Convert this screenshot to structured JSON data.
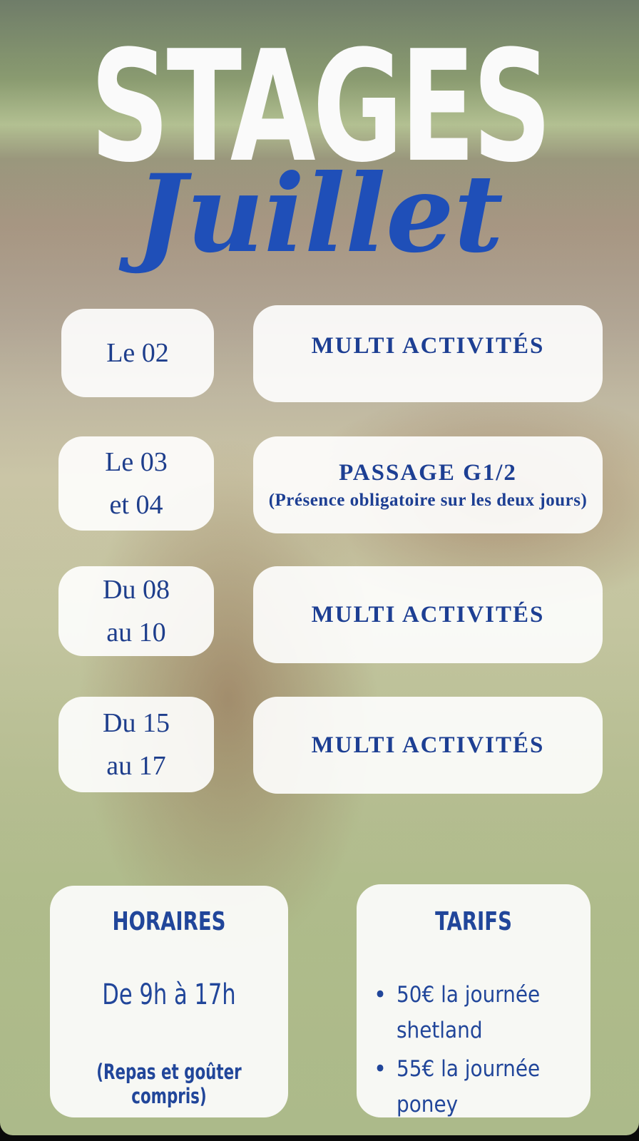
{
  "header": {
    "title": "STAGES",
    "subtitle": "Juillet"
  },
  "schedule": [
    {
      "date_line1": "Le 02",
      "date_line2": "",
      "activity": "MULTI ACTIVITÉS",
      "note": ""
    },
    {
      "date_line1": "Le 03",
      "date_line2": "et 04",
      "activity": "PASSAGE G1/2",
      "note": "(Présence obligatoire sur les deux jours)"
    },
    {
      "date_line1": "Du 08",
      "date_line2": "au 10",
      "activity": "MULTI ACTIVITÉS",
      "note": ""
    },
    {
      "date_line1": "Du 15",
      "date_line2": "au 17",
      "activity": "MULTI ACTIVITÉS",
      "note": ""
    }
  ],
  "horaires": {
    "title": "HORAIRES",
    "hours": "De 9h à 17h",
    "note": "(Repas et goûter compris)"
  },
  "tarifs": {
    "title": "TARIFS",
    "items": [
      "50€ la journée shetland",
      "55€ la journée poney"
    ]
  },
  "colors": {
    "accent_blue": "#1f4fb8",
    "text_blue": "#1d3f93",
    "pill_bg": "#ffffff"
  }
}
